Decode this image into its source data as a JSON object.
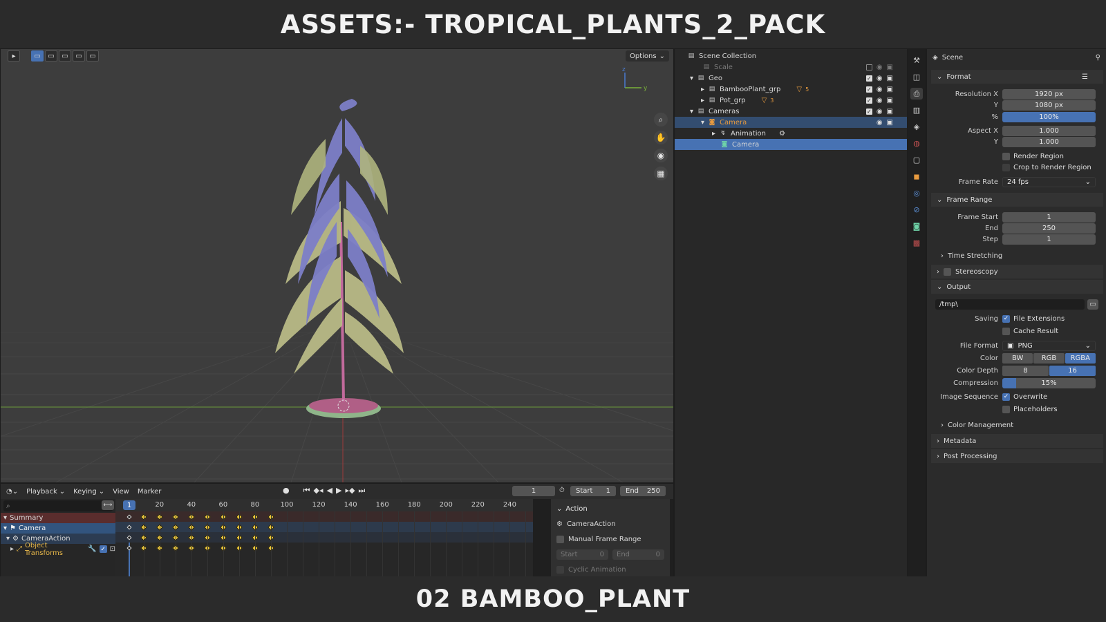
{
  "banner": {
    "top_title": "ASSETS:- TROPICAL_PLANTS_2_PACK",
    "bottom_title": "02 BAMBOO_PLANT"
  },
  "viewport": {
    "options_label": "Options",
    "gizmo": {
      "z": "z",
      "y": "y"
    }
  },
  "timeline": {
    "menus": [
      "Playback",
      "Keying",
      "View",
      "Marker"
    ],
    "current_frame": "1",
    "start_label": "Start",
    "start_value": "1",
    "end_label": "End",
    "end_value": "250",
    "ruler_ticks": [
      "20",
      "40",
      "60",
      "80",
      "100",
      "120",
      "140",
      "160",
      "180",
      "200",
      "220",
      "240"
    ],
    "playhead_frame": "1",
    "channels": {
      "summary": "Summary",
      "camera": "Camera",
      "action": "CameraAction",
      "transforms": "Object Transforms"
    },
    "keyframe_frames": [
      1,
      10,
      20,
      30,
      40,
      50,
      60,
      70,
      80,
      90
    ],
    "action_panel": {
      "title": "Action",
      "action_name": "CameraAction",
      "manual_range": "Manual Frame Range",
      "start_label": "Start",
      "start_value": "0",
      "end_label": "End",
      "end_value": "0",
      "cyclic": "Cyclic Animation"
    }
  },
  "outliner": {
    "root": "Scene Collection",
    "items": {
      "scale": "Scale",
      "geo": "Geo",
      "bamboo": "BambooPlant_grp",
      "bamboo_count": "5",
      "pot": "Pot_grp",
      "pot_count": "3",
      "cameras": "Cameras",
      "camera_obj": "Camera",
      "animation": "Animation",
      "camera_data": "Camera"
    }
  },
  "properties": {
    "scene_label": "Scene",
    "format": {
      "title": "Format",
      "res_x_label": "Resolution X",
      "res_x": "1920 px",
      "res_y_label": "Y",
      "res_y": "1080 px",
      "pct_label": "%",
      "pct": "100%",
      "aspect_x_label": "Aspect X",
      "aspect_x": "1.000",
      "aspect_y_label": "Y",
      "aspect_y": "1.000",
      "render_region": "Render Region",
      "crop_region": "Crop to Render Region",
      "frame_rate_label": "Frame Rate",
      "frame_rate": "24 fps"
    },
    "frame_range": {
      "title": "Frame Range",
      "start_label": "Frame Start",
      "start": "1",
      "end_label": "End",
      "end": "250",
      "step_label": "Step",
      "step": "1",
      "time_stretching": "Time Stretching"
    },
    "stereoscopy": "Stereoscopy",
    "output": {
      "title": "Output",
      "path": "/tmp\\",
      "saving_label": "Saving",
      "file_extensions": "File Extensions",
      "cache_result": "Cache Result",
      "file_format_label": "File Format",
      "file_format": "PNG",
      "color_label": "Color",
      "color_options": [
        "BW",
        "RGB",
        "RGBA"
      ],
      "color_depth_label": "Color Depth",
      "color_depth_options": [
        "8",
        "16"
      ],
      "compression_label": "Compression",
      "compression": "15%",
      "image_sequence_label": "Image Sequence",
      "overwrite": "Overwrite",
      "placeholders": "Placeholders",
      "color_management": "Color Management"
    },
    "metadata": "Metadata",
    "post_processing": "Post Processing"
  },
  "colors": {
    "accent": "#4772b3",
    "keyframe": "#e9c53a",
    "viewport_bg": "#3d3d3d"
  }
}
